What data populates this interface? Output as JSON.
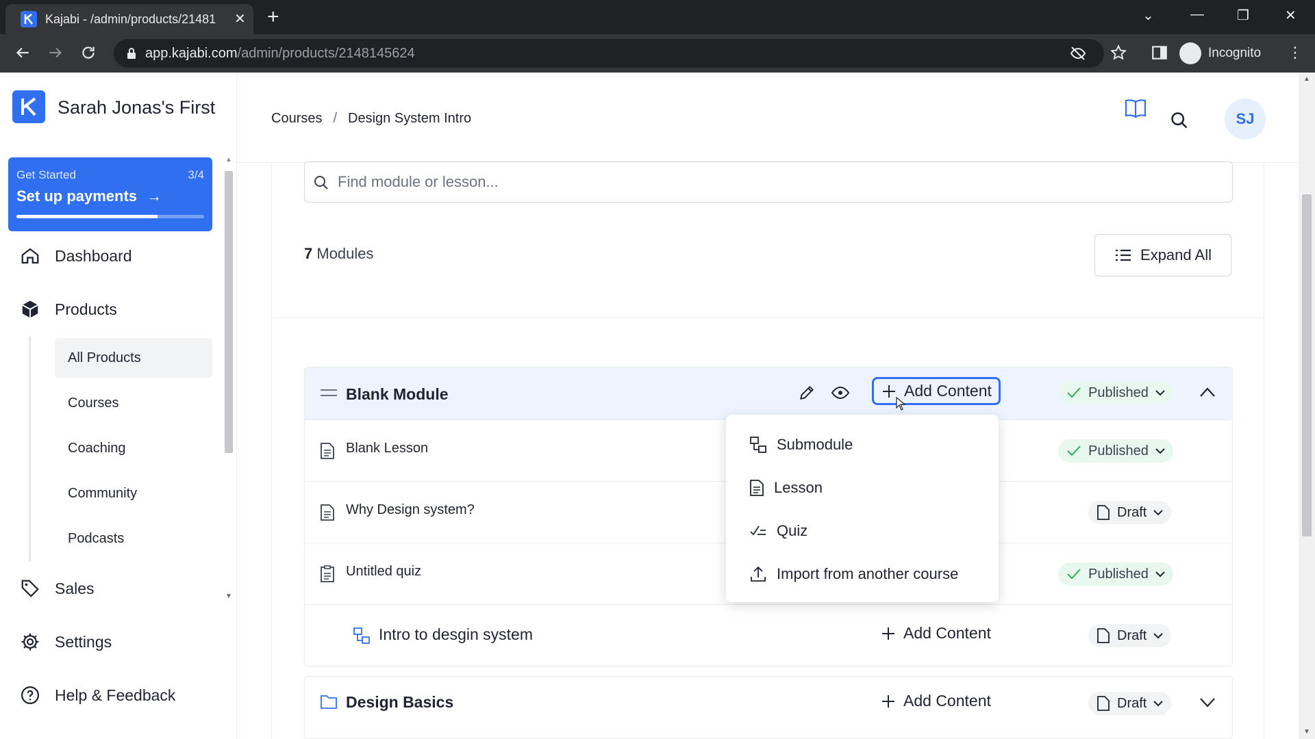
{
  "browser": {
    "tab_title": "Kajabi - /admin/products/21481",
    "url_host": "app.kajabi.com",
    "url_path": "/admin/products/2148145624",
    "profile_label": "Incognito"
  },
  "sidebar": {
    "brand_name": "Sarah Jonas's First",
    "promo": {
      "label": "Get Started",
      "count": "3/4",
      "title": "Set up payments",
      "progress": 0.75
    },
    "nav": {
      "dashboard": "Dashboard",
      "products": "Products",
      "sales": "Sales",
      "settings": "Settings",
      "help": "Help & Feedback"
    },
    "products_sub": [
      "All Products",
      "Courses",
      "Coaching",
      "Community",
      "Podcasts"
    ]
  },
  "header": {
    "breadcrumb": [
      "Courses",
      "Design System Intro"
    ],
    "breadcrumb_sep": "/",
    "avatar_initials": "SJ"
  },
  "main": {
    "search_placeholder": "Find module or lesson...",
    "module_count": "7",
    "module_count_label": "Modules",
    "expand_all": "Expand All",
    "add_content": "Add Content",
    "module1": {
      "title": "Blank Module",
      "status": "Published",
      "rows": [
        {
          "label": "Blank Lesson",
          "status": "Published"
        },
        {
          "label": "Why Design system?",
          "status": "Draft"
        },
        {
          "label": "Untitled quiz",
          "status": "Published"
        },
        {
          "label": "Intro to desgin system",
          "status": "Draft"
        }
      ]
    },
    "module2": {
      "title": "Design Basics",
      "status": "Draft"
    },
    "dropdown": [
      "Submodule",
      "Lesson",
      "Quiz",
      "Import from another course"
    ]
  },
  "colors": {
    "accent": "#2f6ff0",
    "published_bg": "#e9f8ee",
    "published_check": "#2fae5a",
    "module_header_bg": "#eef4ff"
  }
}
